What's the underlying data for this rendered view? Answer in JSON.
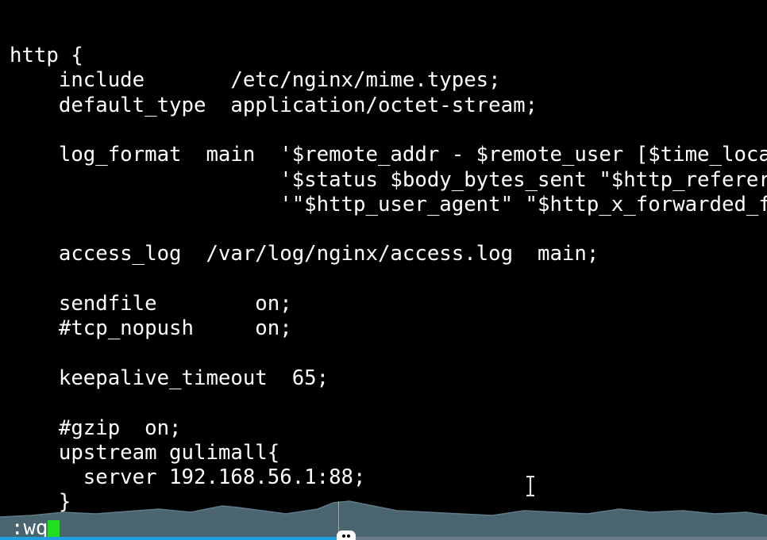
{
  "editor": {
    "lines": [
      "http {",
      "    include       /etc/nginx/mime.types;",
      "    default_type  application/octet-stream;",
      "",
      "    log_format  main  '$remote_addr - $remote_user [$time_local] \"$request\" '",
      "                      '$status $body_bytes_sent \"$http_referer\" '",
      "                      '\"$http_user_agent\" \"$http_x_forwarded_for\"';",
      "",
      "    access_log  /var/log/nginx/access.log  main;",
      "",
      "    sendfile        on;",
      "    #tcp_nopush     on;",
      "",
      "    keepalive_timeout  65;",
      "",
      "    #gzip  on;",
      "    upstream gulimall{",
      "      server 192.168.56.1:88;",
      "    }"
    ],
    "command_line": ":wq"
  },
  "player": {
    "progress_fraction": 0.44
  },
  "icons": {
    "mouse_cursor": "i-beam-cursor-icon",
    "playhead": "playhead-handle-icon"
  },
  "colors": {
    "background": "#000000",
    "text": "#ffffff",
    "cursor": "#22dd22",
    "waveform": "#4a6470",
    "progress_fill": "#1fa0e0"
  }
}
